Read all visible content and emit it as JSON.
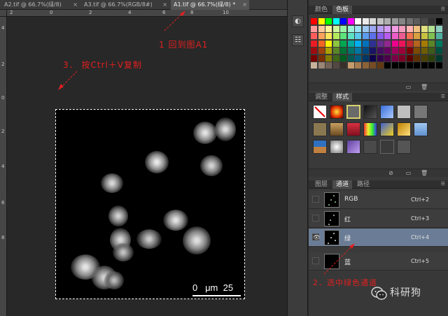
{
  "document_tabs": [
    {
      "label": "A2.tif @ 66.7%(绿/8)",
      "close": "×",
      "active": false
    },
    {
      "label": "A3.tif @ 66.7%(RGB/8#)",
      "close": "×",
      "active": false
    },
    {
      "label": "A1.tif @ 66.7%(绿/8) *",
      "close": "×",
      "active": true
    }
  ],
  "ruler_top_labels": [
    "2",
    "0",
    "2",
    "4",
    "6",
    "8",
    "10"
  ],
  "ruler_left_labels": [
    "4",
    "2",
    "0",
    "2",
    "4",
    "6",
    "8"
  ],
  "canvas": {
    "scale_bar_text": "0   μm  25"
  },
  "annotations": {
    "step1": "1 回到图A1",
    "step2": "2．选中绿色通道",
    "step3": "3． 按Ctrl＋V复制"
  },
  "dock": {
    "icons": [
      "color-panel-icon",
      "adjust-panel-icon"
    ]
  },
  "color_panel": {
    "tabs": [
      "颜色",
      "色板"
    ],
    "active_tab": "色板",
    "swatch_colors": [
      [
        "#ff0000",
        "#ffff00",
        "#00ff00",
        "#00ffff",
        "#0000ff",
        "#ff00ff",
        "#ffffff",
        "#ebebeb",
        "#d6d6d6",
        "#c2c2c2",
        "#adadad",
        "#999999",
        "#858585",
        "#707070",
        "#5c5c5c",
        "#474747",
        "#333333",
        "#000000"
      ],
      [
        "#ff9b9b",
        "#ffc99b",
        "#fff39b",
        "#cdf59b",
        "#9bf0a8",
        "#9bf0d8",
        "#9be3f2",
        "#9bc8f2",
        "#9ba7f2",
        "#b59bf2",
        "#d39bf2",
        "#f29be3",
        "#f29bbd",
        "#ffb3b3",
        "#f0c080",
        "#e0e080",
        "#b0e090",
        "#90d0c0"
      ],
      [
        "#ff5c5c",
        "#ffa35c",
        "#ffe55c",
        "#b4ea5c",
        "#5ce27a",
        "#5ce2c2",
        "#5cc8ec",
        "#5c9cec",
        "#5c6fec",
        "#885cec",
        "#b85cec",
        "#ec5cc8",
        "#ec5c90",
        "#f07050",
        "#d8a040",
        "#c8c040",
        "#80c050",
        "#50b0a0"
      ],
      [
        "#ed1c24",
        "#f26522",
        "#fff200",
        "#8dc63f",
        "#00a651",
        "#00a99d",
        "#00aeef",
        "#0072bc",
        "#2e3192",
        "#662d91",
        "#92278f",
        "#ec008c",
        "#ed145b",
        "#c1272d",
        "#b5651d",
        "#a67c00",
        "#598527",
        "#007a5e"
      ],
      [
        "#9e0b0f",
        "#a0410d",
        "#aba000",
        "#598527",
        "#007236",
        "#00746b",
        "#0076a3",
        "#004a80",
        "#1b1464",
        "#440e62",
        "#630460",
        "#9e005d",
        "#9e0039",
        "#7b0000",
        "#7c4a00",
        "#6d5d00",
        "#3d5a1a",
        "#004f3f"
      ],
      [
        "#790000",
        "#7b2e00",
        "#827b00",
        "#406618",
        "#005e20",
        "#005952",
        "#005b7f",
        "#003663",
        "#0d004c",
        "#32004b",
        "#4b0049",
        "#7b0046",
        "#7a0026",
        "#5a0000",
        "#5a3000",
        "#4a4000",
        "#2a400a",
        "#00382c"
      ],
      [
        "#c7b299",
        "#998675",
        "#736357",
        "#534741",
        "#37302a",
        "#c69c6d",
        "#a67c52",
        "#8c6239",
        "#754c24",
        "#603913",
        "#000000",
        "#000000",
        "#000000",
        "#000000",
        "#000000",
        "#000000",
        "#000000",
        "#000000"
      ]
    ]
  },
  "styles_panel": {
    "tabs": [
      "调整",
      "样式"
    ],
    "active_tab": "样式"
  },
  "channels_panel": {
    "tabs": [
      "图层",
      "通道",
      "路径"
    ],
    "active_tab": "通道",
    "rows": [
      {
        "name": "RGB",
        "shortcut": "Ctrl+2",
        "visible": false,
        "selected": false
      },
      {
        "name": "红",
        "shortcut": "Ctrl+3",
        "visible": false,
        "selected": false
      },
      {
        "name": "绿",
        "shortcut": "Ctrl+4",
        "visible": true,
        "selected": true
      },
      {
        "name": "蓝",
        "shortcut": "Ctrl+5",
        "visible": false,
        "selected": false
      }
    ]
  },
  "watermark": {
    "text": "科研狗"
  }
}
